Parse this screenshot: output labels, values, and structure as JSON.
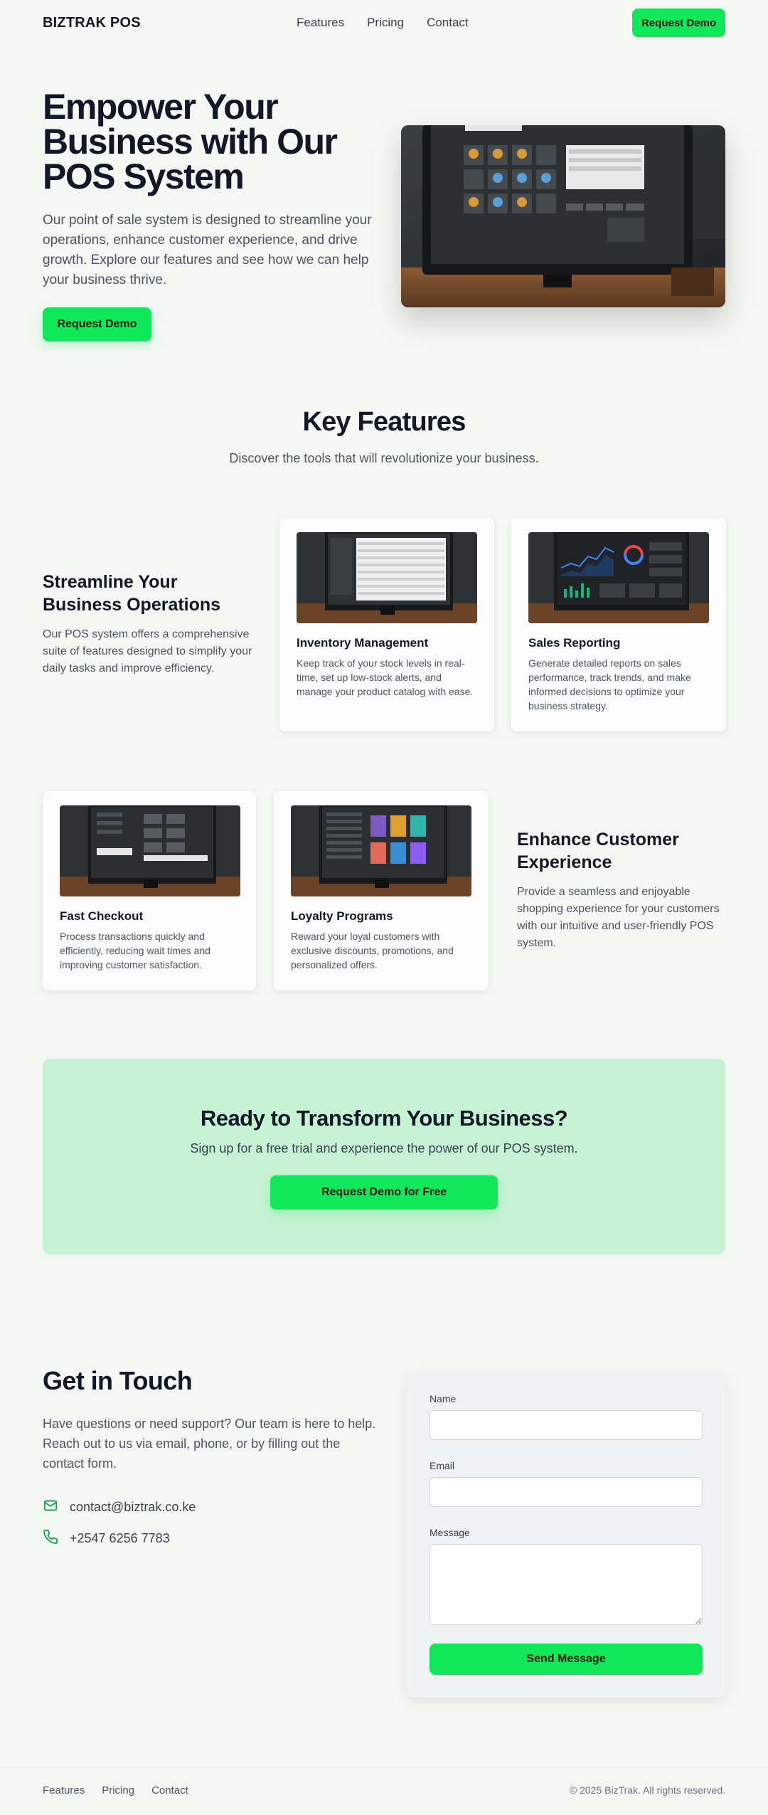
{
  "header": {
    "logo": "BIZTRAK POS",
    "nav": [
      "Features",
      "Pricing",
      "Contact"
    ],
    "cta": "Request Demo"
  },
  "hero": {
    "title": "Empower Your Business with Our POS System",
    "description": "Our point of sale system is designed to streamline your operations, enhance customer experience, and drive growth. Explore our features and see how we can help your business thrive.",
    "cta": "Request Demo",
    "image_alt": "pos-monitor-photo"
  },
  "features": {
    "title": "Key Features",
    "subtitle": "Discover the tools that will revolutionize your business.",
    "group1": {
      "title": "Streamline Your Business Operations",
      "description": "Our POS system offers a comprehensive suite of features designed to simplify your daily tasks and improve efficiency."
    },
    "group2": {
      "title": "Enhance Customer Experience",
      "description": "Provide a seamless and enjoyable shopping experience for your customers with our intuitive and user-friendly POS system."
    },
    "cards": [
      {
        "title": "Inventory Management",
        "description": "Keep track of your stock levels in real-time, set up low-stock alerts, and manage your product catalog with ease."
      },
      {
        "title": "Sales Reporting",
        "description": "Generate detailed reports on sales performance, track trends, and make informed decisions to optimize your business strategy."
      },
      {
        "title": "Fast Checkout",
        "description": "Process transactions quickly and efficiently, reducing wait times and improving customer satisfaction."
      },
      {
        "title": "Loyalty Programs",
        "description": "Reward your loyal customers with exclusive discounts, promotions, and personalized offers."
      }
    ]
  },
  "cta": {
    "title": "Ready to Transform Your Business?",
    "subtitle": "Sign up for a free trial and experience the power of our POS system.",
    "button": "Request Demo for Free"
  },
  "contact": {
    "title": "Get in Touch",
    "description": "Have questions or need support? Our team is here to help. Reach out to us via email, phone, or by filling out the contact form.",
    "email": "contact@biztrak.co.ke",
    "phone": "+2547 6256 7783",
    "form": {
      "name_label": "Name",
      "email_label": "Email",
      "message_label": "Message",
      "submit": "Send Message"
    }
  },
  "footer": {
    "links": [
      "Features",
      "Pricing",
      "Contact"
    ],
    "copyright": "© 2025 BizTrak. All rights reserved."
  },
  "colors": {
    "accent": "#10e85a",
    "background": "#f5f7f5",
    "cta_bg": "#c6f3d3",
    "heading": "#111827",
    "body_text": "#4b5563"
  },
  "icons": {
    "email": "mail-icon",
    "phone": "phone-icon"
  }
}
